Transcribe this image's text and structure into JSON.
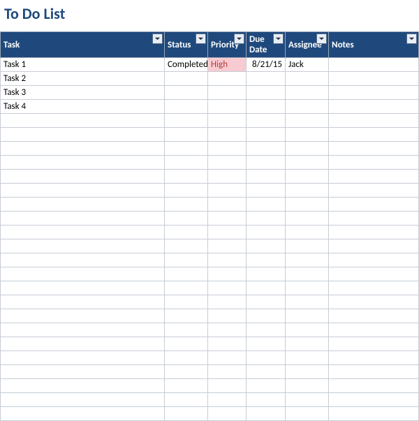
{
  "title": "To Do List",
  "columns": {
    "task": "Task",
    "status": "Status",
    "priority": "Priority",
    "due_date": "Due Date",
    "assignee": "Assignee",
    "notes": "Notes"
  },
  "rows": [
    {
      "task": "Task 1",
      "status": "Completed",
      "priority": "High",
      "priority_high": true,
      "due_date": "8/21/15",
      "assignee": "Jack",
      "notes": ""
    },
    {
      "task": "Task 2",
      "status": "",
      "priority": "",
      "priority_high": false,
      "due_date": "",
      "assignee": "",
      "notes": ""
    },
    {
      "task": "Task 3",
      "status": "",
      "priority": "",
      "priority_high": false,
      "due_date": "",
      "assignee": "",
      "notes": ""
    },
    {
      "task": "Task 4",
      "status": "",
      "priority": "",
      "priority_high": false,
      "due_date": "",
      "assignee": "",
      "notes": ""
    },
    {
      "task": "",
      "status": "",
      "priority": "",
      "priority_high": false,
      "due_date": "",
      "assignee": "",
      "notes": ""
    },
    {
      "task": "",
      "status": "",
      "priority": "",
      "priority_high": false,
      "due_date": "",
      "assignee": "",
      "notes": ""
    },
    {
      "task": "",
      "status": "",
      "priority": "",
      "priority_high": false,
      "due_date": "",
      "assignee": "",
      "notes": ""
    },
    {
      "task": "",
      "status": "",
      "priority": "",
      "priority_high": false,
      "due_date": "",
      "assignee": "",
      "notes": ""
    },
    {
      "task": "",
      "status": "",
      "priority": "",
      "priority_high": false,
      "due_date": "",
      "assignee": "",
      "notes": ""
    },
    {
      "task": "",
      "status": "",
      "priority": "",
      "priority_high": false,
      "due_date": "",
      "assignee": "",
      "notes": ""
    },
    {
      "task": "",
      "status": "",
      "priority": "",
      "priority_high": false,
      "due_date": "",
      "assignee": "",
      "notes": ""
    },
    {
      "task": "",
      "status": "",
      "priority": "",
      "priority_high": false,
      "due_date": "",
      "assignee": "",
      "notes": ""
    },
    {
      "task": "",
      "status": "",
      "priority": "",
      "priority_high": false,
      "due_date": "",
      "assignee": "",
      "notes": ""
    },
    {
      "task": "",
      "status": "",
      "priority": "",
      "priority_high": false,
      "due_date": "",
      "assignee": "",
      "notes": ""
    },
    {
      "task": "",
      "status": "",
      "priority": "",
      "priority_high": false,
      "due_date": "",
      "assignee": "",
      "notes": ""
    },
    {
      "task": "",
      "status": "",
      "priority": "",
      "priority_high": false,
      "due_date": "",
      "assignee": "",
      "notes": ""
    },
    {
      "task": "",
      "status": "",
      "priority": "",
      "priority_high": false,
      "due_date": "",
      "assignee": "",
      "notes": ""
    },
    {
      "task": "",
      "status": "",
      "priority": "",
      "priority_high": false,
      "due_date": "",
      "assignee": "",
      "notes": ""
    },
    {
      "task": "",
      "status": "",
      "priority": "",
      "priority_high": false,
      "due_date": "",
      "assignee": "",
      "notes": ""
    },
    {
      "task": "",
      "status": "",
      "priority": "",
      "priority_high": false,
      "due_date": "",
      "assignee": "",
      "notes": ""
    },
    {
      "task": "",
      "status": "",
      "priority": "",
      "priority_high": false,
      "due_date": "",
      "assignee": "",
      "notes": ""
    },
    {
      "task": "",
      "status": "",
      "priority": "",
      "priority_high": false,
      "due_date": "",
      "assignee": "",
      "notes": ""
    },
    {
      "task": "",
      "status": "",
      "priority": "",
      "priority_high": false,
      "due_date": "",
      "assignee": "",
      "notes": ""
    },
    {
      "task": "",
      "status": "",
      "priority": "",
      "priority_high": false,
      "due_date": "",
      "assignee": "",
      "notes": ""
    },
    {
      "task": "",
      "status": "",
      "priority": "",
      "priority_high": false,
      "due_date": "",
      "assignee": "",
      "notes": ""
    },
    {
      "task": "",
      "status": "",
      "priority": "",
      "priority_high": false,
      "due_date": "",
      "assignee": "",
      "notes": ""
    }
  ]
}
